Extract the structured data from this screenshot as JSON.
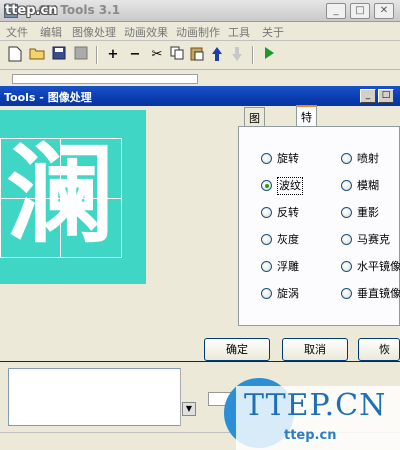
{
  "brand": "ttep.cn",
  "app": {
    "title": "CV Tools 3.1",
    "window_buttons": [
      "_",
      "□",
      "✕"
    ]
  },
  "menu": [
    "文件",
    "编辑",
    "图像处理",
    "动画效果",
    "动画制作",
    "工具",
    "关于"
  ],
  "toolbar_icons": [
    "new-icon",
    "open-icon",
    "save-icon",
    "saveas-icon",
    "add-icon",
    "remove-icon",
    "cut-icon",
    "copy-icon",
    "paste-icon",
    "up-icon",
    "down-icon",
    "play-icon"
  ],
  "dialog": {
    "title": "Tools - 图像处理",
    "window_buttons": [
      "_",
      "□"
    ],
    "preview_char": "澜",
    "tabs": [
      "图像属性",
      "特殊效果"
    ],
    "active_tab": "特殊效果",
    "options_left": [
      "旋转",
      "波纹",
      "反转",
      "灰度",
      "浮雕",
      "旋涡"
    ],
    "options_right": [
      "喷射",
      "模糊",
      "重影",
      "马赛克",
      "水平镜像",
      "垂直镜像"
    ],
    "selected_option": "波纹",
    "buttons": {
      "ok": "确定",
      "cancel": "取消",
      "restore": "恢复"
    }
  },
  "watermark": {
    "main": "TTEP.CN",
    "sub": "ttep.cn"
  },
  "colors": {
    "preview_bg": "#3fd6c5",
    "dialog_title_bg": "#0a3db0",
    "tab_highlight": "#e68b2c",
    "radio_dot": "#21a121"
  }
}
